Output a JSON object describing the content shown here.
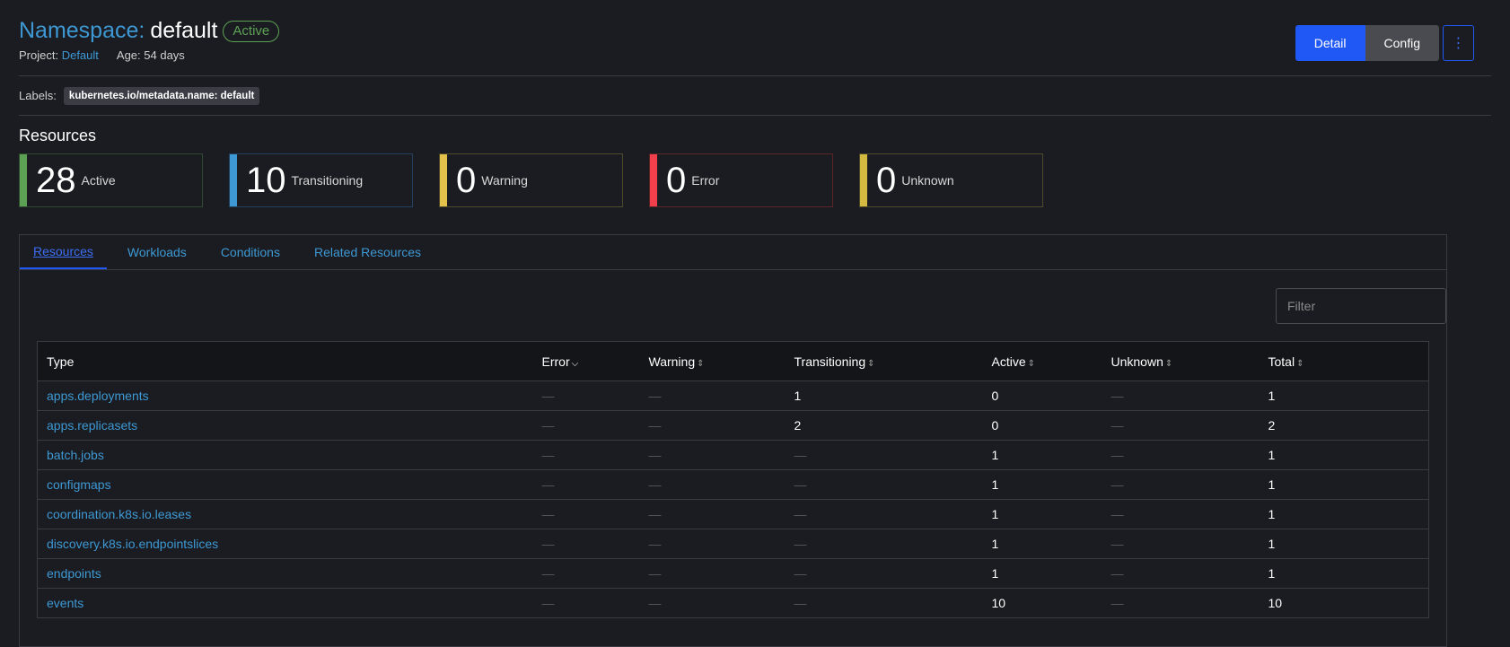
{
  "header": {
    "title_label": "Namespace:",
    "title_name": "default",
    "state": "Active",
    "project_label": "Project:",
    "project_value": "Default",
    "age": "Age: 54 days",
    "btn_detail": "Detail",
    "btn_config": "Config",
    "kebab_glyph": "⋮"
  },
  "labels": {
    "label": "Labels:",
    "chip": "kubernetes.io/metadata.name: default"
  },
  "resources_title": "Resources",
  "cards": [
    {
      "count": "28",
      "label": "Active"
    },
    {
      "count": "10",
      "label": "Transitioning"
    },
    {
      "count": "0",
      "label": "Warning"
    },
    {
      "count": "0",
      "label": "Error"
    },
    {
      "count": "0",
      "label": "Unknown"
    }
  ],
  "tabs": [
    "Resources",
    "Workloads",
    "Conditions",
    "Related Resources"
  ],
  "filter_placeholder": "Filter",
  "table": {
    "headers": [
      "Type",
      "Error",
      "Warning",
      "Transitioning",
      "Active",
      "Unknown",
      "Total"
    ],
    "rows": [
      [
        "apps.deployments",
        "—",
        "—",
        "1",
        "0",
        "—",
        "1"
      ],
      [
        "apps.replicasets",
        "—",
        "—",
        "2",
        "0",
        "—",
        "2"
      ],
      [
        "batch.jobs",
        "—",
        "—",
        "—",
        "1",
        "—",
        "1"
      ],
      [
        "configmaps",
        "—",
        "—",
        "—",
        "1",
        "—",
        "1"
      ],
      [
        "coordination.k8s.io.leases",
        "—",
        "—",
        "—",
        "1",
        "—",
        "1"
      ],
      [
        "discovery.k8s.io.endpointslices",
        "—",
        "—",
        "—",
        "1",
        "—",
        "1"
      ],
      [
        "endpoints",
        "—",
        "—",
        "—",
        "1",
        "—",
        "1"
      ],
      [
        "events",
        "—",
        "—",
        "—",
        "10",
        "—",
        "10"
      ]
    ]
  },
  "colors": {
    "accent_blue": "#1f58f5",
    "link_blue": "#3d98d3",
    "active_green": "#5da254",
    "warning_yellow": "#e3c14b",
    "error_red": "#f1404c"
  }
}
